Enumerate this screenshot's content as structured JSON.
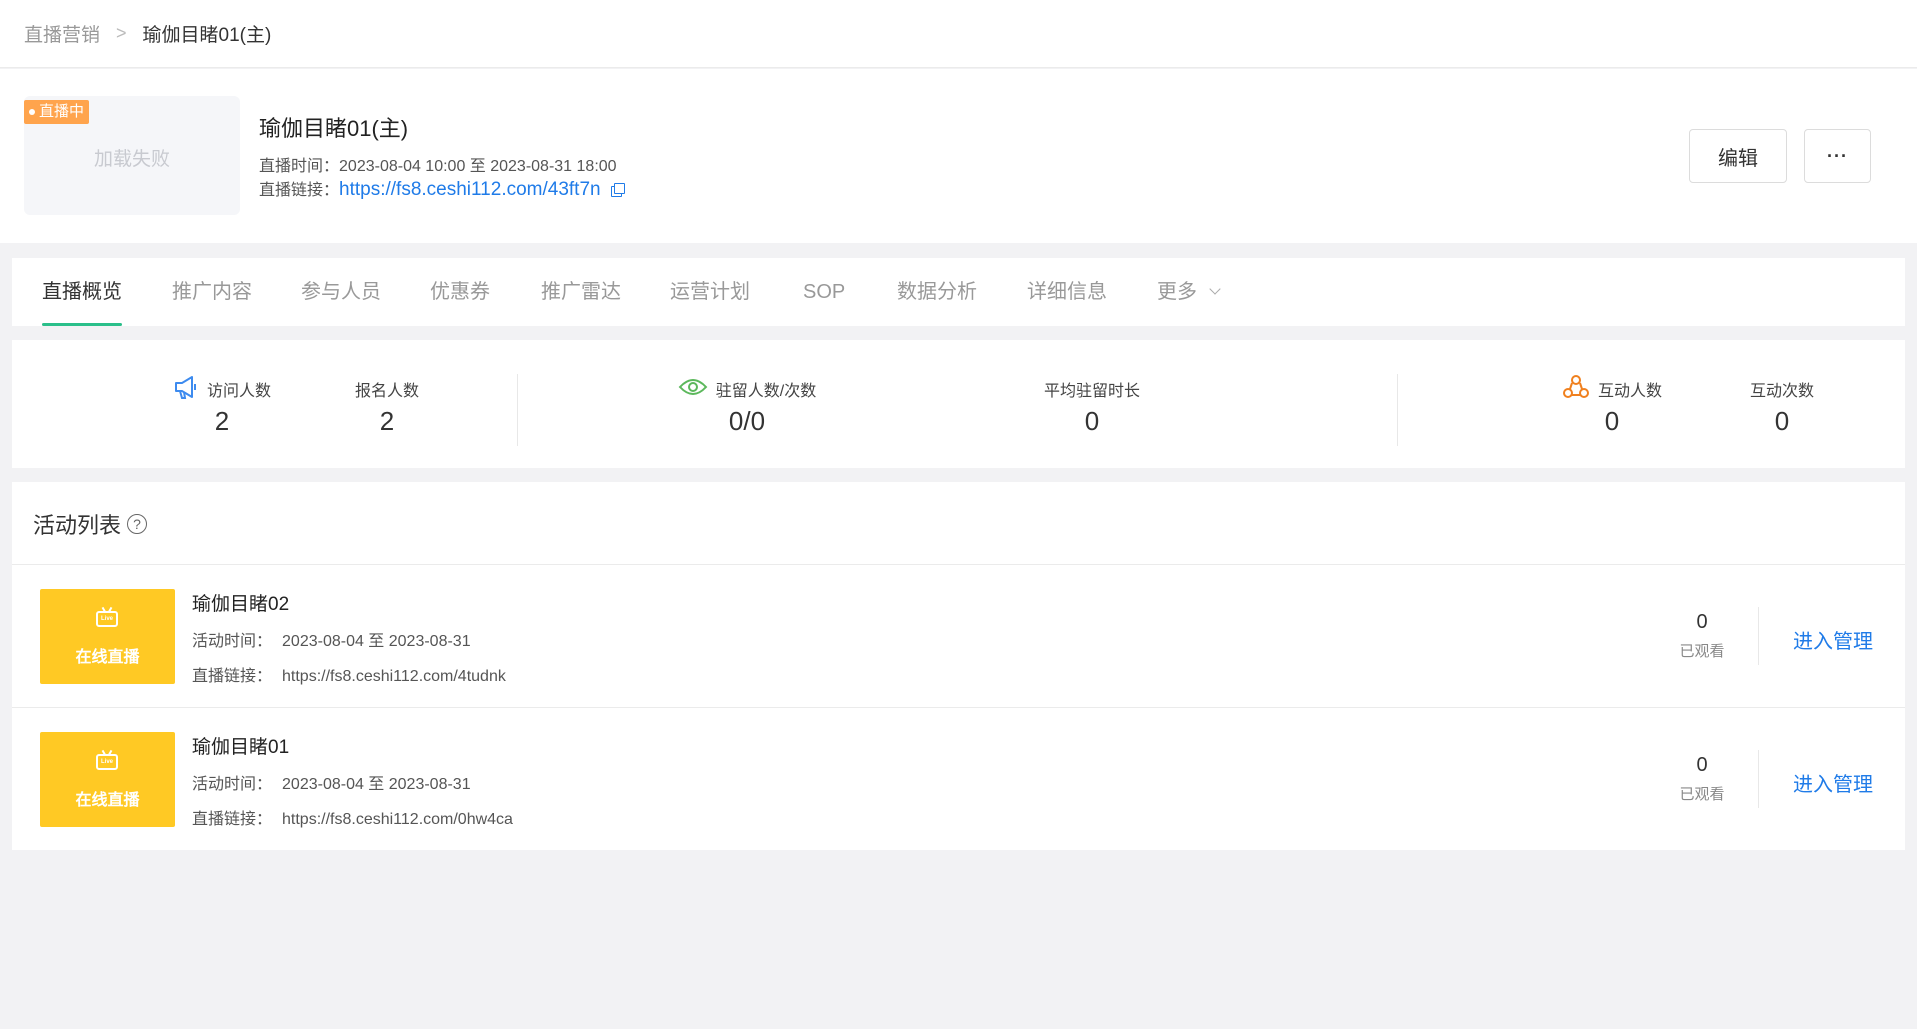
{
  "breadcrumb": {
    "root": "直播营销",
    "separator": ">",
    "current": "瑜伽目睹01(主)"
  },
  "header": {
    "badge": "直播中",
    "cover_fail": "加载失败",
    "title": "瑜伽目睹01(主)",
    "time_label": "直播时间：",
    "time_value": "2023-08-04 10:00 至 2023-08-31 18:00",
    "link_label": "直播链接：",
    "link_value": "https://fs8.ceshi112.com/43ft7n",
    "edit_label": "编辑",
    "more_label": "···"
  },
  "tabs": [
    {
      "label": "直播概览",
      "active": true
    },
    {
      "label": "推广内容"
    },
    {
      "label": "参与人员"
    },
    {
      "label": "优惠券"
    },
    {
      "label": "推广雷达"
    },
    {
      "label": "运营计划"
    },
    {
      "label": "SOP"
    },
    {
      "label": "数据分析"
    },
    {
      "label": "详细信息"
    },
    {
      "label": "更多"
    }
  ],
  "stats": [
    {
      "label": "访问人数",
      "value": "2"
    },
    {
      "label": "报名人数",
      "value": "2"
    },
    {
      "label": "驻留人数/次数",
      "value": "0/0"
    },
    {
      "label": "平均驻留时长",
      "value": "0"
    },
    {
      "label": "互动人数",
      "value": "0"
    },
    {
      "label": "互动次数",
      "value": "0"
    }
  ],
  "colors": {
    "accent": "#2bbf8a",
    "link": "#1f7be8",
    "badge": "#ffa44d",
    "thumb": "#ffc924"
  },
  "list": {
    "title": "活动列表",
    "help": "?",
    "items": [
      {
        "thumb_tv": "Live",
        "thumb_label": "在线直播",
        "title": "瑜伽目睹02",
        "time_label": "活动时间：",
        "time_value": "2023-08-04 至 2023-08-31",
        "link_label": "直播链接：",
        "link_value": "https://fs8.ceshi112.com/4tudnk",
        "watched": "0",
        "watched_label": "已观看",
        "action": "进入管理"
      },
      {
        "thumb_tv": "Live",
        "thumb_label": "在线直播",
        "title": "瑜伽目睹01",
        "time_label": "活动时间：",
        "time_value": "2023-08-04 至 2023-08-31",
        "link_label": "直播链接：",
        "link_value": "https://fs8.ceshi112.com/0hw4ca",
        "watched": "0",
        "watched_label": "已观看",
        "action": "进入管理"
      }
    ]
  }
}
